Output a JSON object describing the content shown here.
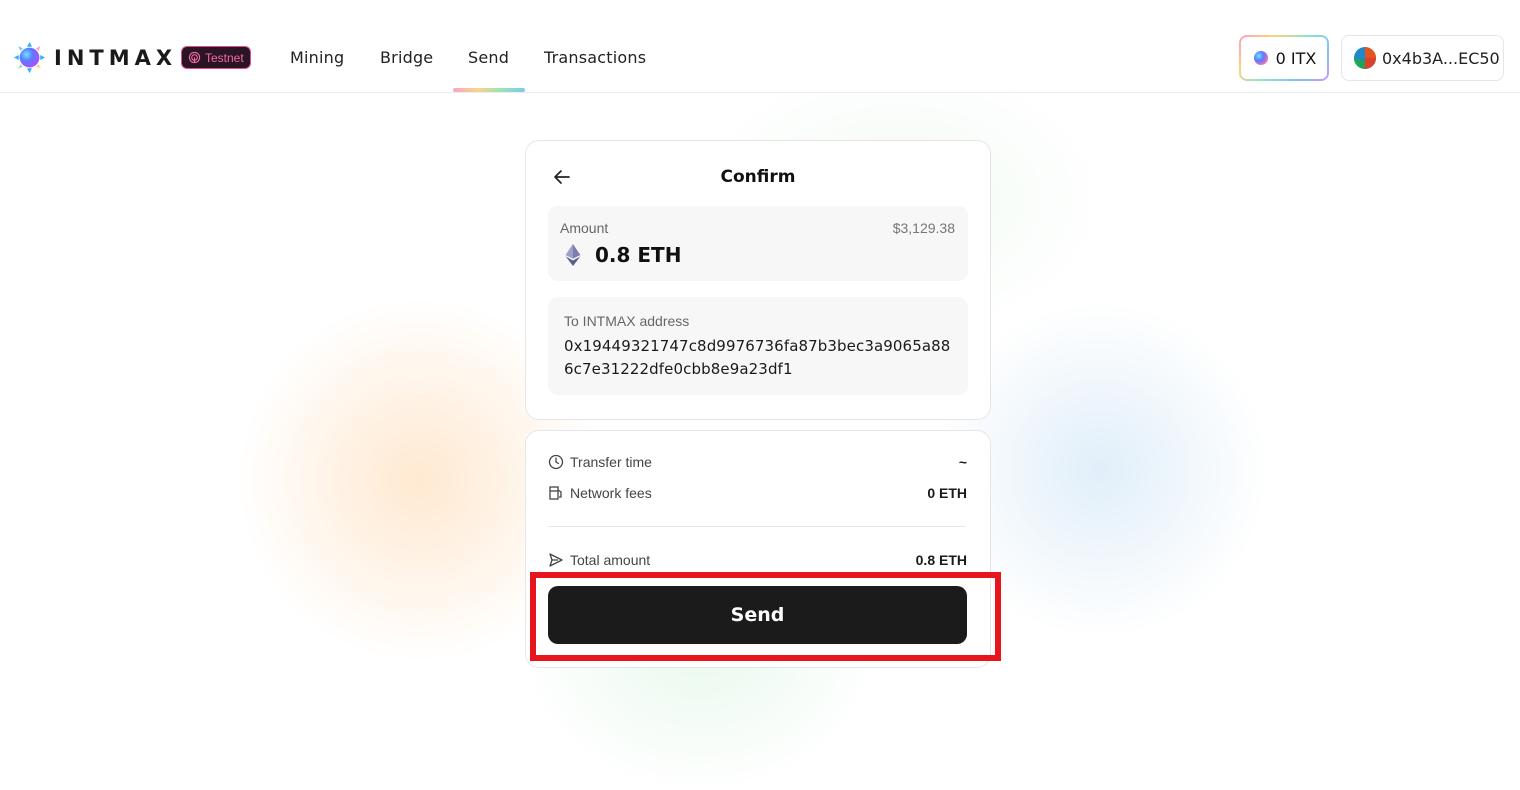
{
  "header": {
    "logo_text": "INTMAX",
    "network_badge": "Testnet",
    "nav": [
      {
        "label": "Mining"
      },
      {
        "label": "Bridge"
      },
      {
        "label": "Send",
        "active": true
      },
      {
        "label": "Transactions"
      }
    ],
    "balance_label": "0 ITX",
    "wallet_address": "0x4b3A...EC50"
  },
  "confirm": {
    "title": "Confirm",
    "amount_label": "Amount",
    "amount_usd": "$3,129.38",
    "amount_value": "0.8 ETH",
    "to_label": "To INTMAX address",
    "address_line1": "0x19449321747c8d9976736fa87b3bec3a9065a88",
    "address_line2": "6c7e31222dfe0cbb8e9a23df1"
  },
  "summary": {
    "transfer_time_label": "Transfer time",
    "transfer_time_value": "~",
    "network_fees_label": "Network fees",
    "network_fees_value": "0 ETH",
    "total_label": "Total amount",
    "total_value": "0.8 ETH",
    "send_label": "Send"
  },
  "colors": {
    "accent_pink": "#e0508f",
    "send_button": "#1b1b1b",
    "highlight": "#e8161c"
  }
}
